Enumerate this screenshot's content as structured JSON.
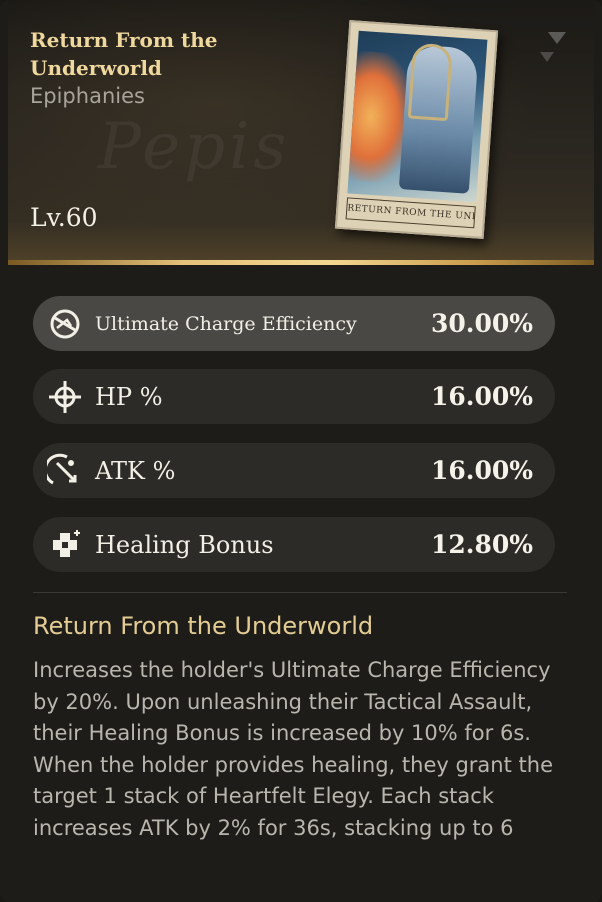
{
  "item": {
    "title": "Return From the Underworld",
    "category": "Epiphanies",
    "level": "Lv.60",
    "cover_label": "RETURN FROM THE UNDERWORLD"
  },
  "stats": [
    {
      "label": "Ultimate Charge Efficiency",
      "value": "30.00%",
      "icon": "ultimate-charge-icon",
      "highlighted": true
    },
    {
      "label": "HP %",
      "value": "16.00%",
      "icon": "crosshair-hp-icon",
      "highlighted": false
    },
    {
      "label": "ATK %",
      "value": "16.00%",
      "icon": "atk-icon",
      "highlighted": false
    },
    {
      "label": "Healing Bonus",
      "value": "12.80%",
      "icon": "healing-cross-icon",
      "highlighted": false
    }
  ],
  "effect": {
    "title": "Return From the Underworld",
    "description": "Increases the holder's Ultimate Charge Efficiency by 20%. Upon unleashing their Tactical Assault, their Healing Bonus is increased by 10% for 6s. When the holder provides healing, they grant the target 1 stack of Heartfelt Elegy. Each stack increases ATK by 2% for 36s, stacking up to 6"
  },
  "colors": {
    "title_gold": "#efd89e",
    "effect_title": "#e4cd93",
    "highlight_row": "#4a4844",
    "row": "#2d2b28",
    "panel": "#1e1c19"
  }
}
